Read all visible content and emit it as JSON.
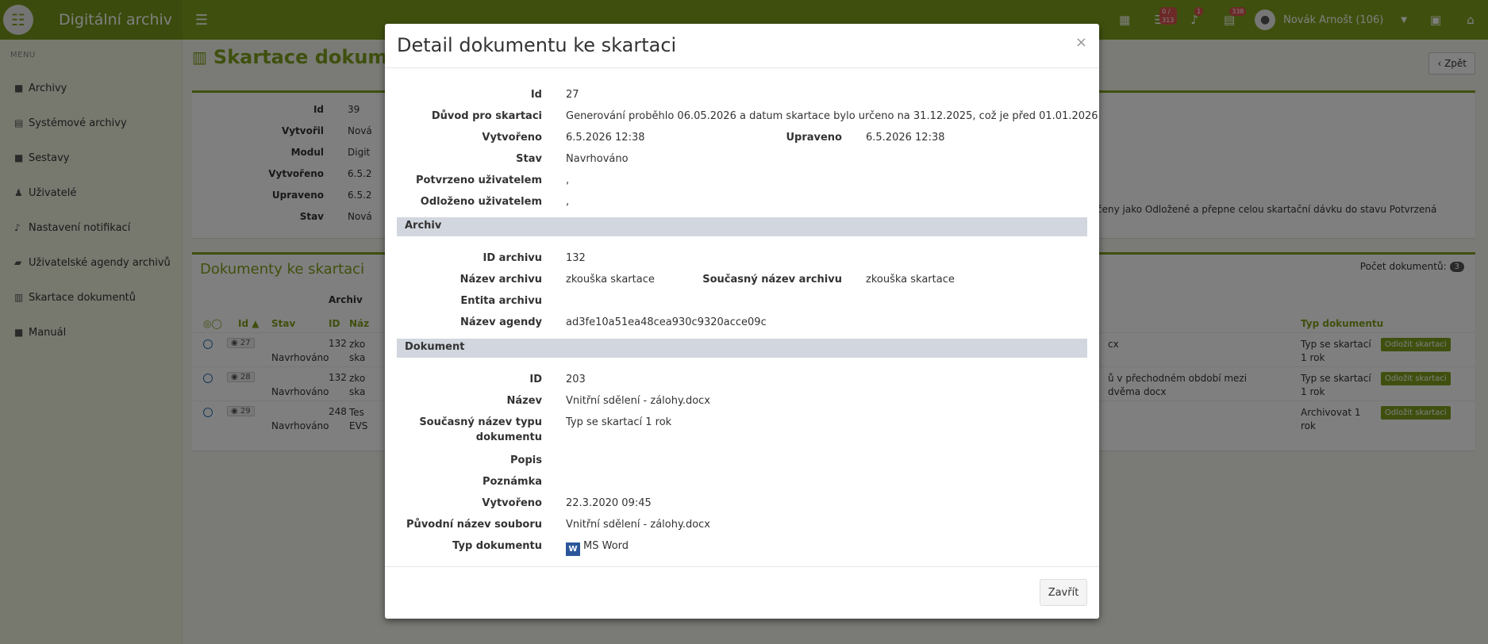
{
  "app": {
    "title": "Digitální archiv"
  },
  "header": {
    "badges": {
      "tasks": "0 / 313",
      "notifications": "1",
      "docs": "338"
    },
    "user": "Novák Arnošt (106)"
  },
  "sidebar": {
    "heading": "MENU",
    "items": [
      {
        "label": "Archivy",
        "icon": "book-icon"
      },
      {
        "label": "Systémové archivy",
        "icon": "server-icon"
      },
      {
        "label": "Sestavy",
        "icon": "book-icon"
      },
      {
        "label": "Uživatelé",
        "icon": "users-icon"
      },
      {
        "label": "Nastavení notifikací",
        "icon": "bell-icon"
      },
      {
        "label": "Uživatelské agendy archivů",
        "icon": "folder-open-icon"
      },
      {
        "label": "Skartace dokumentů",
        "icon": "trash-icon"
      },
      {
        "label": "Manuál",
        "icon": "book-icon"
      }
    ]
  },
  "page": {
    "title": "Skartace dokumentů",
    "back_label": "Zpět",
    "info": [
      {
        "label": "Id",
        "value": "39"
      },
      {
        "label": "Vytvořil",
        "value": "Nová"
      },
      {
        "label": "Modul",
        "value": "Digit"
      },
      {
        "label": "Vytvořeno",
        "value": "6.5.2"
      },
      {
        "label": "Upraveno",
        "value": "6.5.2"
      },
      {
        "label": "Stav",
        "value": "Nová"
      }
    ],
    "info_note": "čeny jako Odložené a přepne celou skartační dávku do stavu Potvrzená"
  },
  "docs_table": {
    "title": "Dokumenty ke skartaci",
    "count_label": "Počet dokumentů:",
    "count": "3",
    "group_header": "Archiv",
    "headers": {
      "id": "Id",
      "stav": "Stav",
      "archiv_id": "ID",
      "name": "Náz",
      "typ": "Typ dokumentu"
    },
    "rows": [
      {
        "id": "27",
        "stav": "Navrhováno",
        "archiv_id": "132",
        "name": "zko ska",
        "doc": "cx",
        "typ": "Typ se skartací 1 rok",
        "action": "Odložit skartaci"
      },
      {
        "id": "28",
        "stav": "Navrhováno",
        "archiv_id": "132",
        "name": "zko ska",
        "doc": "ů v přechodném období mezi dvěma docx",
        "typ": "Typ se skartací 1 rok",
        "action": "Odložit skartaci"
      },
      {
        "id": "29",
        "stav": "Navrhováno",
        "archiv_id": "248",
        "name": "Tes EVS",
        "doc": "",
        "typ": "Archivovat 1 rok",
        "action": "Odložit skartaci"
      }
    ]
  },
  "modal": {
    "title": "Detail dokumentu ke skartaci",
    "close_symbol": "×",
    "general": {
      "id_label": "Id",
      "id": "27",
      "reason_label": "Důvod pro skartaci",
      "reason": "Generování proběhlo 06.05.2026 a datum skartace bylo určeno na 31.12.2025, což je před 01.01.2026",
      "created_label": "Vytvořeno",
      "created": "6.5.2026 12:38",
      "updated_label": "Upraveno",
      "updated": "6.5.2026 12:38",
      "state_label": "Stav",
      "state": "Navrhováno",
      "confirmed_label": "Potvrzeno uživatelem",
      "confirmed": ",",
      "postponed_label": "Odloženo uživatelem",
      "postponed": ","
    },
    "archive_section": "Archiv",
    "archive": {
      "id_label": "ID archivu",
      "id": "132",
      "name_label": "Název archivu",
      "name": "zkouška skartace",
      "current_name_label": "Současný název archivu",
      "current_name": "zkouška skartace",
      "entity_label": "Entita archivu",
      "entity": "",
      "agenda_label": "Název agendy",
      "agenda": "ad3fe10a51ea48cea930c9320acce09c"
    },
    "document_section": "Dokument",
    "document": {
      "id_label": "ID",
      "id": "203",
      "name_label": "Název",
      "name": "Vnitřní sdělení - zálohy.docx",
      "type_name_label": "Současný název typu dokumentu",
      "type_name": "Typ se skartací 1 rok",
      "desc_label": "Popis",
      "desc": "",
      "note_label": "Poznámka",
      "note": "",
      "created_label": "Vytvořeno",
      "created": "22.3.2020 09:45",
      "orig_file_label": "Původní název souboru",
      "orig_file": "Vnitřní sdělení - zálohy.docx",
      "doc_type_label": "Typ dokumentu",
      "doc_type": "MS Word",
      "doc_type_icon": "W"
    },
    "close_button": "Zavřít"
  }
}
